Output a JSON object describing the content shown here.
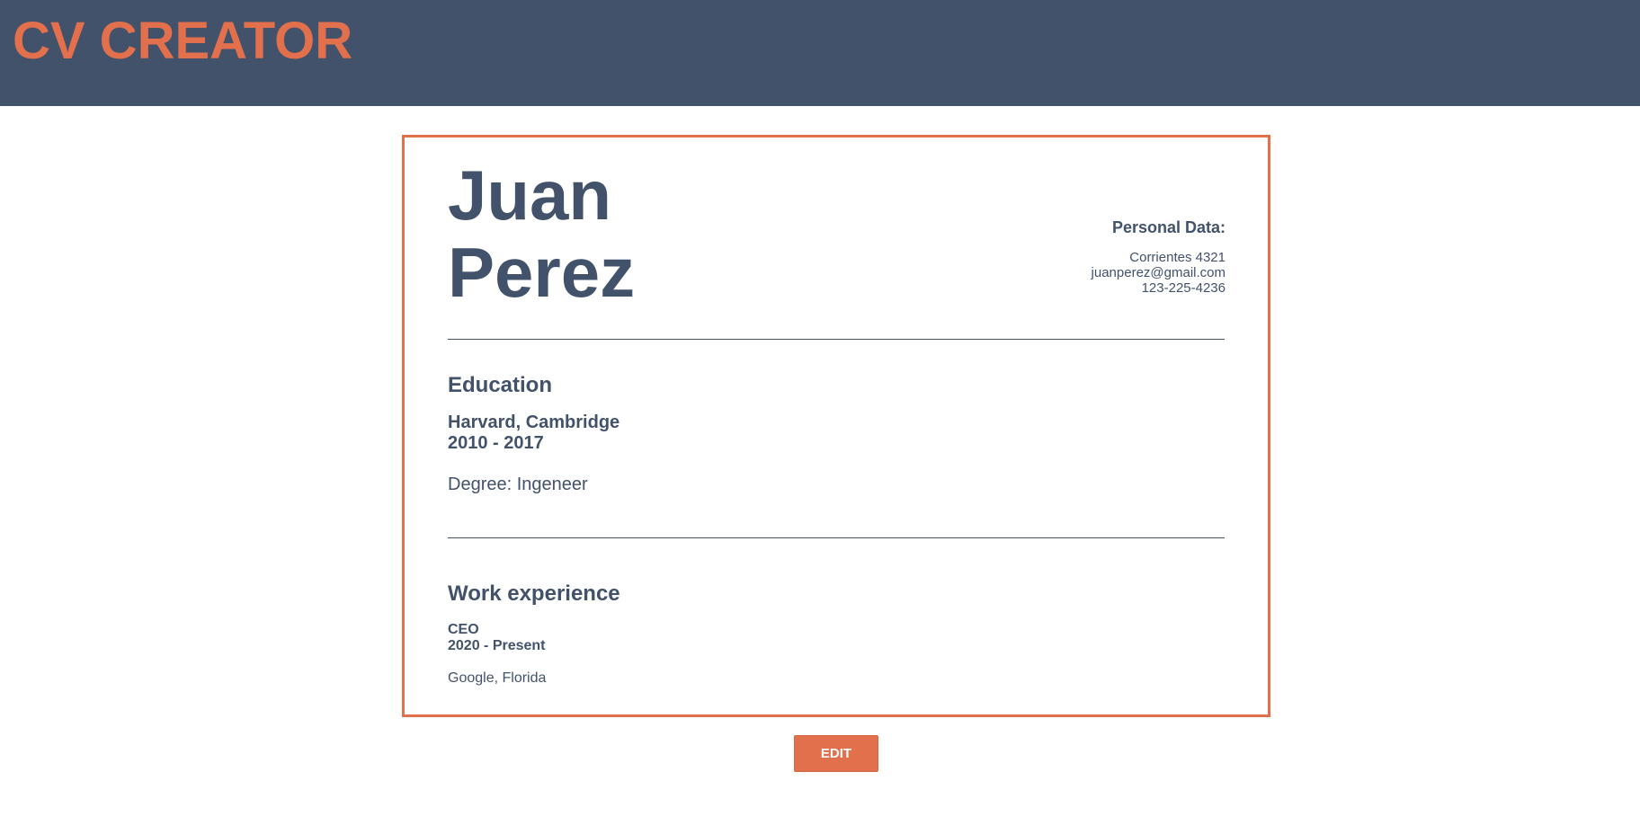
{
  "header": {
    "title": "CV CREATOR"
  },
  "cv": {
    "name": {
      "first": "Juan",
      "last": "Perez"
    },
    "personal": {
      "title": "Personal Data:",
      "address": "Corrientes 4321",
      "email": "juanperez@gmail.com",
      "phone": "123-225-4236"
    },
    "education": {
      "title": "Education",
      "school": "Harvard, Cambridge",
      "dates": "2010 - 2017",
      "degree": "Degree: Ingeneer"
    },
    "work": {
      "title": "Work experience",
      "role": "CEO",
      "dates": "2020 - Present",
      "company": "Google, Florida"
    }
  },
  "actions": {
    "edit_label": "EDIT"
  },
  "colors": {
    "accent": "#e3704c",
    "primary": "#42526b",
    "background": "#ffffff"
  }
}
